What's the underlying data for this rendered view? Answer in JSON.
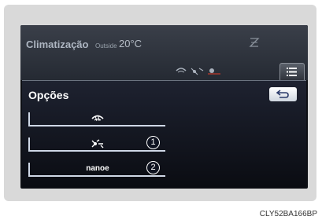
{
  "header": {
    "title": "Climatização",
    "outside_label": "Outside",
    "outside_temp": "20°C",
    "icons": [
      "ac-off-icon",
      "defog-icon",
      "fan-icon",
      "recirculation-icon"
    ]
  },
  "options_panel": {
    "title": "Opções",
    "items": [
      {
        "icon": "defog-icon",
        "label": "",
        "badge": ""
      },
      {
        "icon": "fan-icon",
        "label": "",
        "badge": "1"
      },
      {
        "icon": "",
        "label": "nanoe",
        "badge": "2"
      }
    ]
  },
  "footer": {
    "image_code": "CLY52BA166BP"
  },
  "colors": {
    "accent": "#cfd8e6",
    "screen_bg": "#0d0f14",
    "text": "#ffffff"
  }
}
